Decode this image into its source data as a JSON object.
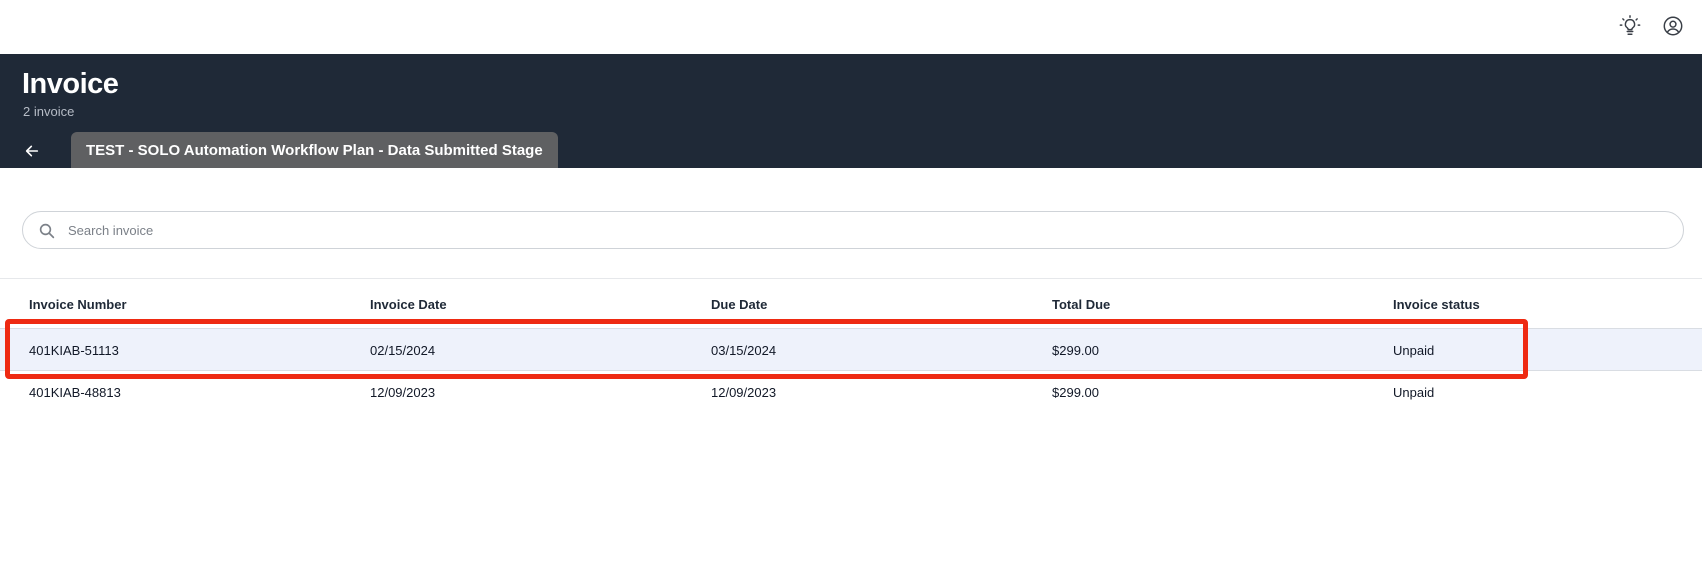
{
  "header": {
    "title": "Invoice",
    "subtitle": "2 invoice",
    "tab_label": "TEST - SOLO Automation Workflow Plan - Data Submitted Stage"
  },
  "topbar": {
    "icons": [
      "lightbulb-icon",
      "account-circle-icon"
    ]
  },
  "search": {
    "placeholder": "Search invoice",
    "value": ""
  },
  "table": {
    "columns": [
      "Invoice Number",
      "Invoice Date",
      "Due Date",
      "Total Due",
      "Invoice status"
    ],
    "rows": [
      [
        "401KIAB-51113",
        "02/15/2024",
        "03/15/2024",
        "$299.00",
        "Unpaid"
      ],
      [
        "401KIAB-48813",
        "12/09/2023",
        "12/09/2023",
        "$299.00",
        "Unpaid"
      ]
    ]
  },
  "colors": {
    "header_bg": "#1f2937",
    "tab_bg": "#5f6062",
    "selected_row_bg": "#eef2fb",
    "highlight_border": "#ee2a12"
  }
}
